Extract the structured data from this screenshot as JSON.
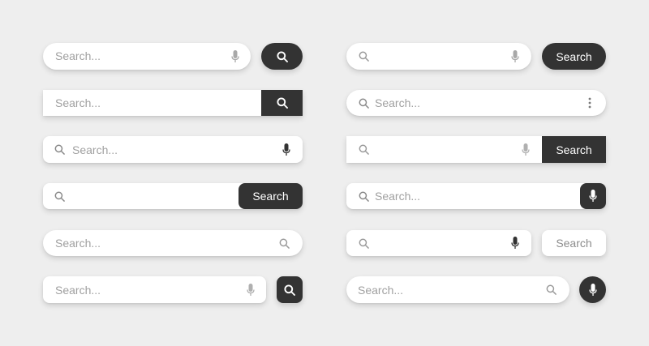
{
  "search": {
    "placeholder": "Search...",
    "button_label": "Search"
  },
  "icons": {
    "search": "search-icon",
    "microphone": "microphone-icon",
    "more": "more-vertical-icon"
  },
  "colors": {
    "background": "#eeeeee",
    "bar": "#ffffff",
    "dark_button": "#333333",
    "placeholder_text": "#a0a0a0"
  }
}
